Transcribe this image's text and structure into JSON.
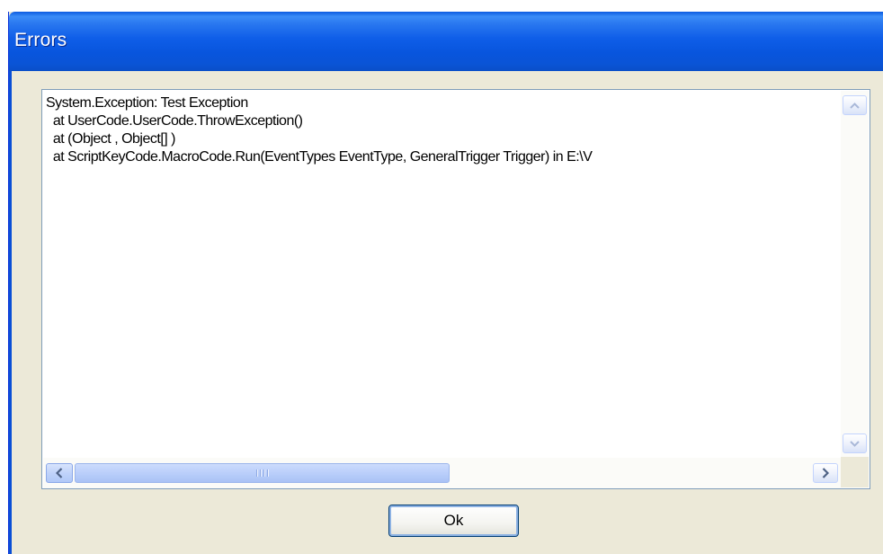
{
  "window": {
    "title": "Errors"
  },
  "error_text": {
    "lines": [
      "System.Exception: Test Exception",
      "  at UserCode.UserCode.ThrowException()",
      "  at (Object , Object[] )",
      "  at ScriptKeyCode.MacroCode.Run(EventTypes EventType, GeneralTrigger Trigger) in E:\\V"
    ]
  },
  "buttons": {
    "ok_label": "Ok"
  },
  "icons": {
    "scroll_up": "chevron-up-icon",
    "scroll_down": "chevron-down-icon",
    "scroll_left": "chevron-left-icon",
    "scroll_right": "chevron-right-icon"
  },
  "colors": {
    "titlebar": "#0a54d6",
    "dialog_background": "#ece9d8",
    "panel_border": "#7f9db9"
  }
}
